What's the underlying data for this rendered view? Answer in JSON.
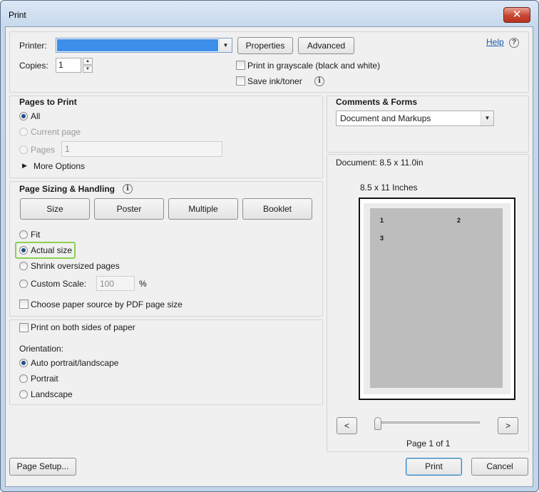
{
  "window": {
    "title": "Print",
    "close_glyph": "✕"
  },
  "printer": {
    "label": "Printer:",
    "selected": "",
    "properties_label": "Properties",
    "advanced_label": "Advanced",
    "help_label": "Help",
    "help_glyph": "?"
  },
  "copies": {
    "label": "Copies:",
    "value": "1",
    "up": "▲",
    "down": "▼"
  },
  "options": {
    "grayscale_label": "Print in grayscale (black and white)",
    "save_ink_label": "Save ink/toner",
    "info_glyph": "i"
  },
  "pages_to_print": {
    "heading": "Pages to Print",
    "all_label": "All",
    "current_page_label": "Current page",
    "pages_label": "Pages",
    "pages_value": "1",
    "more_options_label": "More Options",
    "expand_glyph": "▶",
    "selected": "All"
  },
  "page_sizing": {
    "heading": "Page Sizing & Handling",
    "buttons": [
      "Size",
      "Poster",
      "Multiple",
      "Booklet"
    ],
    "fit_label": "Fit",
    "actual_size_label": "Actual size",
    "shrink_label": "Shrink oversized pages",
    "custom_scale_label": "Custom Scale:",
    "custom_scale_value": "100",
    "percent_label": "%",
    "paper_source_label": "Choose paper source by PDF page size",
    "selected": "Actual size"
  },
  "duplex": {
    "label": "Print on both sides of paper"
  },
  "orientation": {
    "heading": "Orientation:",
    "auto_label": "Auto portrait/landscape",
    "portrait_label": "Portrait",
    "landscape_label": "Landscape",
    "selected": "Auto portrait/landscape"
  },
  "comments_forms": {
    "heading": "Comments & Forms",
    "selected": "Document and Markups",
    "arrow_glyph": "▼"
  },
  "preview": {
    "document_size": "Document: 8.5 x 11.0in",
    "paper_size": "8.5 x 11 Inches",
    "page_numbers": [
      "1",
      "2",
      "3"
    ],
    "prev_glyph": "<",
    "next_glyph": ">",
    "page_indicator": "Page 1 of 1",
    "slider_position": 0
  },
  "footer": {
    "page_setup_label": "Page Setup...",
    "print_label": "Print",
    "cancel_label": "Cancel"
  },
  "colors": {
    "printer_selection": "#3d8ee8",
    "highlight_border": "#8bd14f",
    "preview_page": "#bdbdbd",
    "close_button": "#c74633"
  }
}
